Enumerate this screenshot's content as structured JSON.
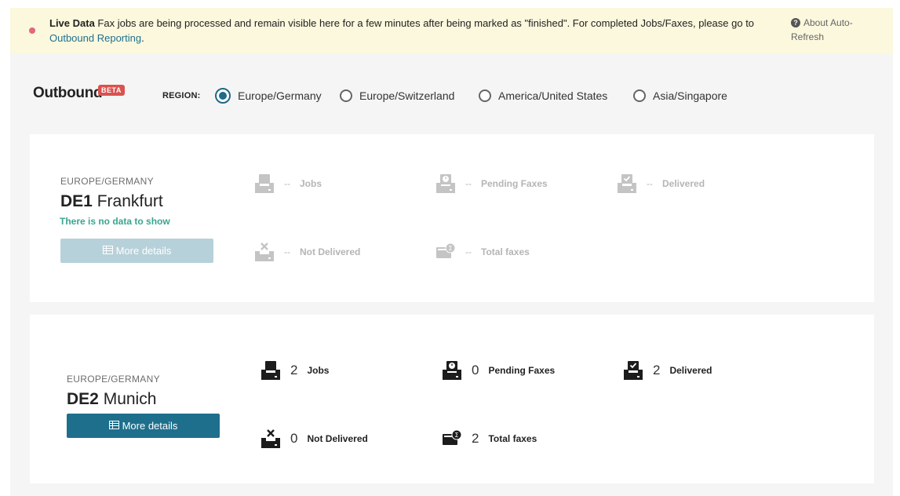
{
  "banner": {
    "title": "Live Data",
    "message": " Fax jobs are being processed and remain visible here for a few minutes after being marked as \"finished\". For completed Jobs/Faxes, please go to ",
    "link": "Outbound Reporting",
    "suffix": ".",
    "about_line1": "About Auto-",
    "about_line2": "Refresh"
  },
  "header": {
    "title": "Outbound",
    "badge": "BETA",
    "region_label": "REGION:",
    "regions": [
      {
        "label": "Europe/Germany",
        "selected": true
      },
      {
        "label": "Europe/Switzerland",
        "selected": false
      },
      {
        "label": "America/United States",
        "selected": false
      },
      {
        "label": "Asia/Singapore",
        "selected": false
      }
    ]
  },
  "sites": [
    {
      "region": "EUROPE/GERMANY",
      "code": "DE1",
      "city": "Frankfurt",
      "nodata": "There is no data to show",
      "button": "More details",
      "stats": {
        "jobs": {
          "value": "--",
          "label": "Jobs"
        },
        "pending": {
          "value": "--",
          "label": "Pending Faxes"
        },
        "delivered": {
          "value": "--",
          "label": "Delivered"
        },
        "not_delivered": {
          "value": "--",
          "label": "Not Delivered"
        },
        "total": {
          "value": "--",
          "label": "Total faxes"
        }
      }
    },
    {
      "region": "EUROPE/GERMANY",
      "code": "DE2",
      "city": "Munich",
      "button": "More details",
      "stats": {
        "jobs": {
          "value": "2",
          "label": "Jobs"
        },
        "pending": {
          "value": "0",
          "label": "Pending Faxes"
        },
        "delivered": {
          "value": "2",
          "label": "Delivered"
        },
        "not_delivered": {
          "value": "0",
          "label": "Not Delivered"
        },
        "total": {
          "value": "2",
          "label": "Total faxes"
        }
      }
    }
  ],
  "colors": {
    "accent": "#1e6f8c",
    "banner_bg": "#fbf8dd",
    "nodata": "#3aa590",
    "beta": "#d9534f"
  },
  "icons": [
    "help-icon",
    "tray-icon",
    "pending-icon",
    "delivered-icon",
    "not-delivered-icon",
    "total-faxes-icon",
    "table-icon"
  ]
}
